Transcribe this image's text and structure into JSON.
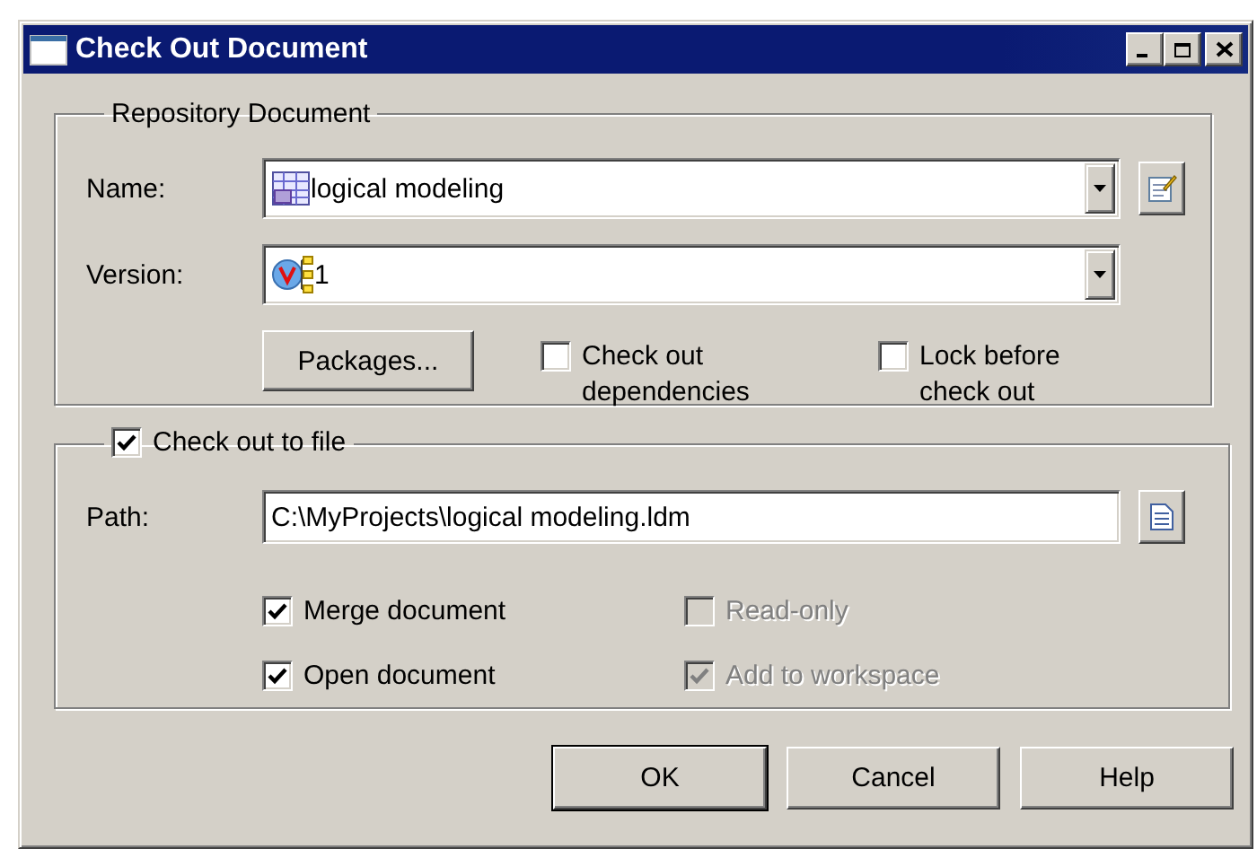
{
  "window": {
    "title": "Check Out Document"
  },
  "repository_document": {
    "label": "Repository Document",
    "name": {
      "label": "Name:",
      "value": "logical modeling"
    },
    "version": {
      "label": "Version:",
      "value": "1"
    },
    "packages_button": "Packages...",
    "options": [
      {
        "label": "Check out dependencies",
        "checked": false
      },
      {
        "label": "Lock before check out",
        "checked": false
      }
    ]
  },
  "check_out_to_file": {
    "label": "Check out to file",
    "checked": true,
    "path": {
      "label": "Path:",
      "value": "C:\\MyProjects\\logical modeling.ldm"
    },
    "options": [
      {
        "label": "Merge document",
        "checked": true,
        "disabled": false
      },
      {
        "label": "Read-only",
        "checked": false,
        "disabled": true
      },
      {
        "label": "Open document",
        "checked": true,
        "disabled": false
      },
      {
        "label": "Add to workspace",
        "checked": true,
        "disabled": true
      }
    ]
  },
  "buttons": [
    {
      "label": "OK",
      "default": true
    },
    {
      "label": "Cancel",
      "default": false
    },
    {
      "label": "Help",
      "default": false
    }
  ]
}
